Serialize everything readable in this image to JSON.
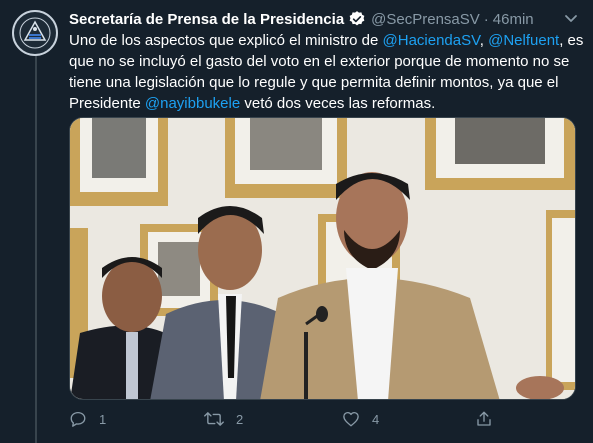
{
  "tweet": {
    "display_name": "Secretaría de Prensa de la Presidencia",
    "handle": "@SecPrensaSV",
    "separator": "·",
    "time": "46min",
    "text_parts": {
      "p1": "Uno de los aspectos que explicó el ministro de ",
      "m1": "@HaciendaSV",
      "p2": ", ",
      "m2": "@Nelfuent",
      "p3": ", es que no se incluyó el gasto del voto en el exterior porque de momento no se tiene una legislación que lo regule y que permita definir montos, ya que el Presidente ",
      "m3": "@nayibbukele",
      "p4": " vetó dos veces las reformas."
    },
    "counts": {
      "replies": "1",
      "retweets": "2",
      "likes": "4"
    }
  },
  "colors": {
    "background": "#15202b",
    "text": "#ffffff",
    "secondary": "#8899a6",
    "accent": "#1da1f2",
    "divider": "#38444d"
  },
  "icons": {
    "avatar": "el-salvador-seal-icon",
    "verified": "verified-badge-icon",
    "more": "chevron-down-icon",
    "reply": "reply-icon",
    "retweet": "retweet-icon",
    "like": "heart-icon",
    "share": "share-icon"
  }
}
